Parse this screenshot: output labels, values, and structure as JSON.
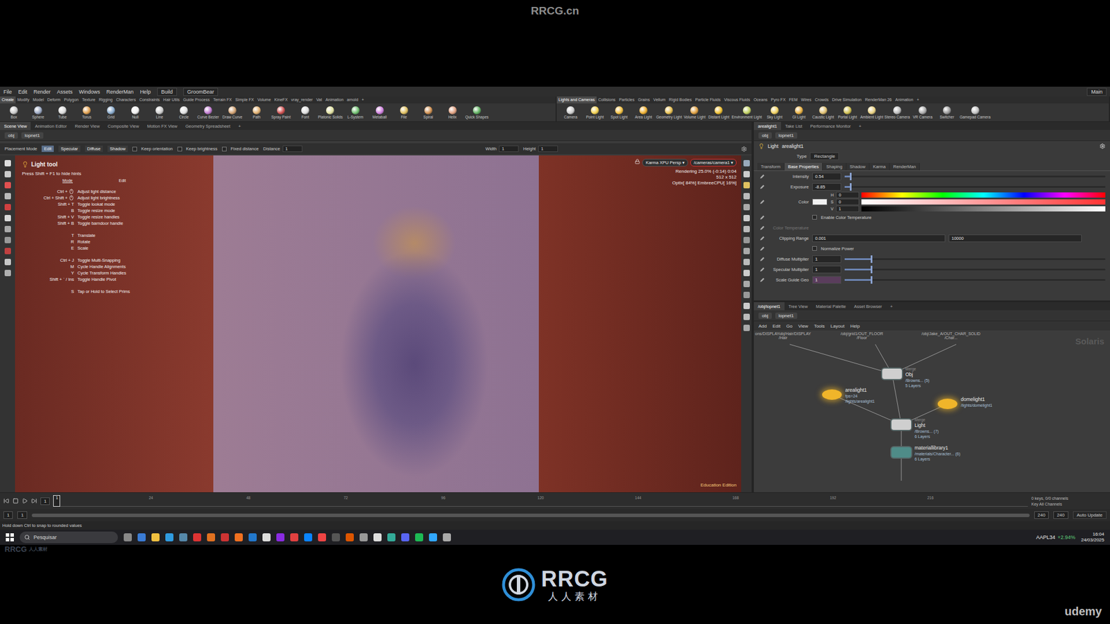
{
  "watermark": {
    "top": "RRCG.cn",
    "logo_main": "RRCG",
    "logo_sub": "人人素材",
    "corner_main": "RRCG",
    "corner_sub": "人人素材",
    "udemy": "udemy"
  },
  "menu": {
    "items": [
      "File",
      "Edit",
      "Render",
      "Assets",
      "Windows",
      "RenderMan",
      "Help"
    ],
    "desktop": "Build",
    "context": "GroomBear",
    "right": "Main"
  },
  "shelf_left": {
    "tabs": [
      {
        "label": "Create",
        "selected": true
      },
      {
        "label": "Modify",
        "selected": false
      },
      {
        "label": "Model",
        "selected": false
      },
      {
        "label": "Deform",
        "selected": false
      },
      {
        "label": "Polygon",
        "selected": false
      },
      {
        "label": "Texture",
        "selected": false
      },
      {
        "label": "Rigging",
        "selected": false
      },
      {
        "label": "Characters",
        "selected": false
      },
      {
        "label": "Constraints",
        "selected": false
      },
      {
        "label": "Hair Utils",
        "selected": false
      },
      {
        "label": "Guide Process",
        "selected": false
      },
      {
        "label": "Terrain FX",
        "selected": false
      },
      {
        "label": "Simple FX",
        "selected": false
      },
      {
        "label": "Volume",
        "selected": false
      },
      {
        "label": "KineFX",
        "selected": false
      },
      {
        "label": "vray_render",
        "selected": false
      },
      {
        "label": "Vat",
        "selected": false
      },
      {
        "label": "Animation",
        "selected": false
      },
      {
        "label": "arnold",
        "selected": false
      },
      {
        "label": "+",
        "selected": false
      }
    ],
    "tools": [
      "Box",
      "Sphere",
      "Tube",
      "Torus",
      "Grid",
      "Null",
      "Line",
      "Circle",
      "Curve Bezier",
      "Draw Curve",
      "Path",
      "Spray Paint",
      "Font",
      "Platonic Solids",
      "L-System",
      "Metaball",
      "File",
      "Spiral",
      "Helix",
      "Quick Shapes"
    ]
  },
  "shelf_right": {
    "tabs": [
      {
        "label": "Lights and Cameras",
        "selected": true
      },
      {
        "label": "Collisions",
        "selected": false
      },
      {
        "label": "Particles",
        "selected": false
      },
      {
        "label": "Grains",
        "selected": false
      },
      {
        "label": "Vellum",
        "selected": false
      },
      {
        "label": "Rigid Bodies",
        "selected": false
      },
      {
        "label": "Particle Fluids",
        "selected": false
      },
      {
        "label": "Viscous Fluids",
        "selected": false
      },
      {
        "label": "Oceans",
        "selected": false
      },
      {
        "label": "Pyro FX",
        "selected": false
      },
      {
        "label": "FEM",
        "selected": false
      },
      {
        "label": "Wires",
        "selected": false
      },
      {
        "label": "Crowds",
        "selected": false
      },
      {
        "label": "Drive Simulation",
        "selected": false
      },
      {
        "label": "RenderMan 26",
        "selected": false
      },
      {
        "label": "Animation",
        "selected": false
      },
      {
        "label": "+",
        "selected": false
      }
    ],
    "tools": [
      "Camera",
      "Point Light",
      "Spot Light",
      "Area Light",
      "Geometry Light",
      "Volume Light",
      "Distant Light",
      "Environment Light",
      "Sky Light",
      "GI Light",
      "Caustic Light",
      "Portal Light",
      "Ambient Light",
      "Stereo Camera",
      "VR Camera",
      "Switcher",
      "Gamepad Camera"
    ]
  },
  "left_pane": {
    "tabs": [
      {
        "label": "Scene View",
        "selected": true
      },
      {
        "label": "Animation Editor",
        "selected": false
      },
      {
        "label": "Render View",
        "selected": false
      },
      {
        "label": "Composite View",
        "selected": false
      },
      {
        "label": "Motion FX View",
        "selected": false
      },
      {
        "label": "Geometry Spreadsheet",
        "selected": false
      },
      {
        "label": "+",
        "selected": false
      }
    ],
    "path": [
      "obj",
      "lopnet1"
    ]
  },
  "right_pane": {
    "tabs": [
      {
        "label": "arealight1",
        "selected": true
      },
      {
        "label": "Take List",
        "selected": false
      },
      {
        "label": "Performance Monitor",
        "selected": false
      },
      {
        "label": "+",
        "selected": false
      }
    ],
    "path": [
      "obj",
      "lopnet1"
    ]
  },
  "tool_options": {
    "mode_label": "Placement Mode",
    "modes": [
      {
        "label": "Edit",
        "selected": true
      },
      {
        "label": "Specular",
        "selected": false
      },
      {
        "label": "Diffuse",
        "selected": false
      },
      {
        "label": "Shadow",
        "selected": false
      }
    ],
    "toggles": [
      {
        "label": "Keep orientation",
        "checked": false
      },
      {
        "label": "Keep brightness",
        "checked": false
      },
      {
        "label": "Fixed distance",
        "checked": false
      }
    ],
    "distance": {
      "label": "Distance",
      "value": "1"
    },
    "width": {
      "label": "Width",
      "value": "1"
    },
    "height": {
      "label": "Height",
      "value": "1"
    }
  },
  "viewport": {
    "hud": {
      "title": "Light tool",
      "hint": "Press Shift + F1 to hide hints",
      "mode_label": "Mode",
      "mode_value": "Edit",
      "items": [
        {
          "keys": "Ctrl +",
          "action": "Adjust light distance",
          "kind": "mouse",
          "group": 1
        },
        {
          "keys": "Ctrl + Shift +",
          "action": "Adjust light brightness",
          "kind": "mouse",
          "group": 1
        },
        {
          "keys": "Shift + T",
          "action": "Toggle lookat mode",
          "kind": "key",
          "group": 1
        },
        {
          "keys": "B",
          "action": "Toggle resize mode",
          "kind": "key",
          "group": 1
        },
        {
          "keys": "Shift + V",
          "action": "Toggle resize handles",
          "kind": "key",
          "group": 1
        },
        {
          "keys": "Shift + B",
          "action": "Toggle barndoor handle",
          "kind": "key",
          "group": 1
        },
        {
          "keys": "T",
          "action": "Translate",
          "kind": "key",
          "group": 2
        },
        {
          "keys": "R",
          "action": "Rotate",
          "kind": "key",
          "group": 2
        },
        {
          "keys": "E",
          "action": "Scale",
          "kind": "key",
          "group": 2
        },
        {
          "keys": "Ctrl + J",
          "action": "Toggle Multi-Snapping",
          "kind": "key",
          "group": 3
        },
        {
          "keys": "M",
          "action": "Cycle Handle Alignments",
          "kind": "key",
          "group": 3
        },
        {
          "keys": "Y",
          "action": "Cycle Transform Handles",
          "kind": "key",
          "group": 3
        },
        {
          "keys": "Shift + ` / Ins",
          "action": "Toggle Handle Pivot",
          "kind": "key",
          "group": 3
        },
        {
          "keys": "S",
          "action": "Tap or Hold to Select Prims",
          "kind": "key",
          "group": 4
        }
      ]
    },
    "renderer": "Karma XPU Persp ▾",
    "camera": "/cameras/camera1 ▾",
    "stats": [
      "Rendering  25.0%  (-0:14)  0:04",
      "512 x 512",
      "Optix[ 84%] EmbreeCPU[ 16%]"
    ],
    "edition": "Education Edition"
  },
  "params": {
    "title": "Light",
    "node": "arealight1",
    "type_label": "Type",
    "type_value": "Rectangle",
    "tabs": [
      {
        "label": "Transform",
        "selected": false
      },
      {
        "label": "Base Properties",
        "selected": true
      },
      {
        "label": "Shaping",
        "selected": false
      },
      {
        "label": "Shadow",
        "selected": false
      },
      {
        "label": "Karma",
        "selected": false
      },
      {
        "label": "RenderMan",
        "selected": false
      }
    ],
    "rows": [
      {
        "kind": "slider",
        "label": "Intensity",
        "value": "0.54",
        "level": 0.02
      },
      {
        "kind": "slider",
        "label": "Exposure",
        "value": "-8.85",
        "level": 0.02
      },
      {
        "kind": "color",
        "label": "Color",
        "channels": [
          {
            "name": "H",
            "value": "0"
          },
          {
            "name": "S",
            "value": "0"
          },
          {
            "name": "V",
            "value": "1"
          }
        ]
      },
      {
        "kind": "toggle",
        "label": "Enable Color Temperature",
        "checked": false
      },
      {
        "kind": "disabled",
        "label": "Color Temperature"
      },
      {
        "kind": "range",
        "label": "Clipping Range",
        "value": "0.001",
        "value2": "10000"
      },
      {
        "kind": "toggle",
        "label": "Normalize Power",
        "checked": false
      },
      {
        "kind": "slider",
        "label": "Diffuse Multiplier",
        "value": "1",
        "level": 0.1
      },
      {
        "kind": "slider",
        "label": "Specular Multiplier",
        "value": "1",
        "level": 0.1
      },
      {
        "kind": "slider",
        "label": "Scale Guide Geo",
        "value": "1",
        "level": 0.1
      }
    ]
  },
  "network": {
    "tabs": [
      {
        "label": "/obj/lopnet1",
        "selected": true
      },
      {
        "label": "Tree View",
        "selected": false
      },
      {
        "label": "Material Palette",
        "selected": false
      },
      {
        "label": "Asset Browser",
        "selected": false
      },
      {
        "label": "+",
        "selected": false
      }
    ],
    "path": [
      "obj",
      "lopnet1"
    ],
    "menu": [
      "Add",
      "Edit",
      "Go",
      "View",
      "Tools",
      "Layout",
      "Help"
    ],
    "context": "Solaris",
    "fragments": [
      {
        "text": "ons/DISPLAYobj/Hair/DISPLAY",
        "sub": "/Hair"
      },
      {
        "text": "/obj/grid1/OUT_FLOOR",
        "sub": "/Floor"
      },
      {
        "text": "/obj/Jake_A/OUT_CHAR_SOLID",
        "sub": "/Char..."
      }
    ],
    "nodes": [
      {
        "kind": "merge",
        "name": "Obj",
        "type": "Merge",
        "lines": [
          "/Browns... (5)",
          "5 Layers"
        ]
      },
      {
        "kind": "light",
        "name": "arealight1",
        "type": "",
        "lines": [
          "fps=24",
          "/lights/arealight1"
        ]
      },
      {
        "kind": "light",
        "name": "domelight1",
        "type": "",
        "lines": [
          "/lights/domelight1"
        ]
      },
      {
        "kind": "merge",
        "name": "Light",
        "type": "Merge",
        "lines": [
          "/Browns... (7)",
          "6 Layers"
        ]
      },
      {
        "kind": "material",
        "name": "materiallibrary1",
        "type": "",
        "lines": [
          "/materials/Character... (6)",
          "6 Layers"
        ]
      }
    ]
  },
  "timeline": {
    "frame": "1",
    "ticks": [
      "24",
      "48",
      "72",
      "96",
      "120",
      "144",
      "168",
      "192",
      "216"
    ],
    "end": "240",
    "keys": "0 keys, 0/0 channels",
    "key_all": "Key All Channels",
    "auto_update": "Auto Update",
    "range": {
      "start": "1",
      "start2": "1",
      "end": "240",
      "end2": "240"
    }
  },
  "status": "Hold down Ctrl to snap to rounded values",
  "taskbar": {
    "search": "Pesquisar",
    "stock": "AAPL34",
    "change": "+2.94%",
    "time": "16:04",
    "date": "24/03/2025"
  }
}
